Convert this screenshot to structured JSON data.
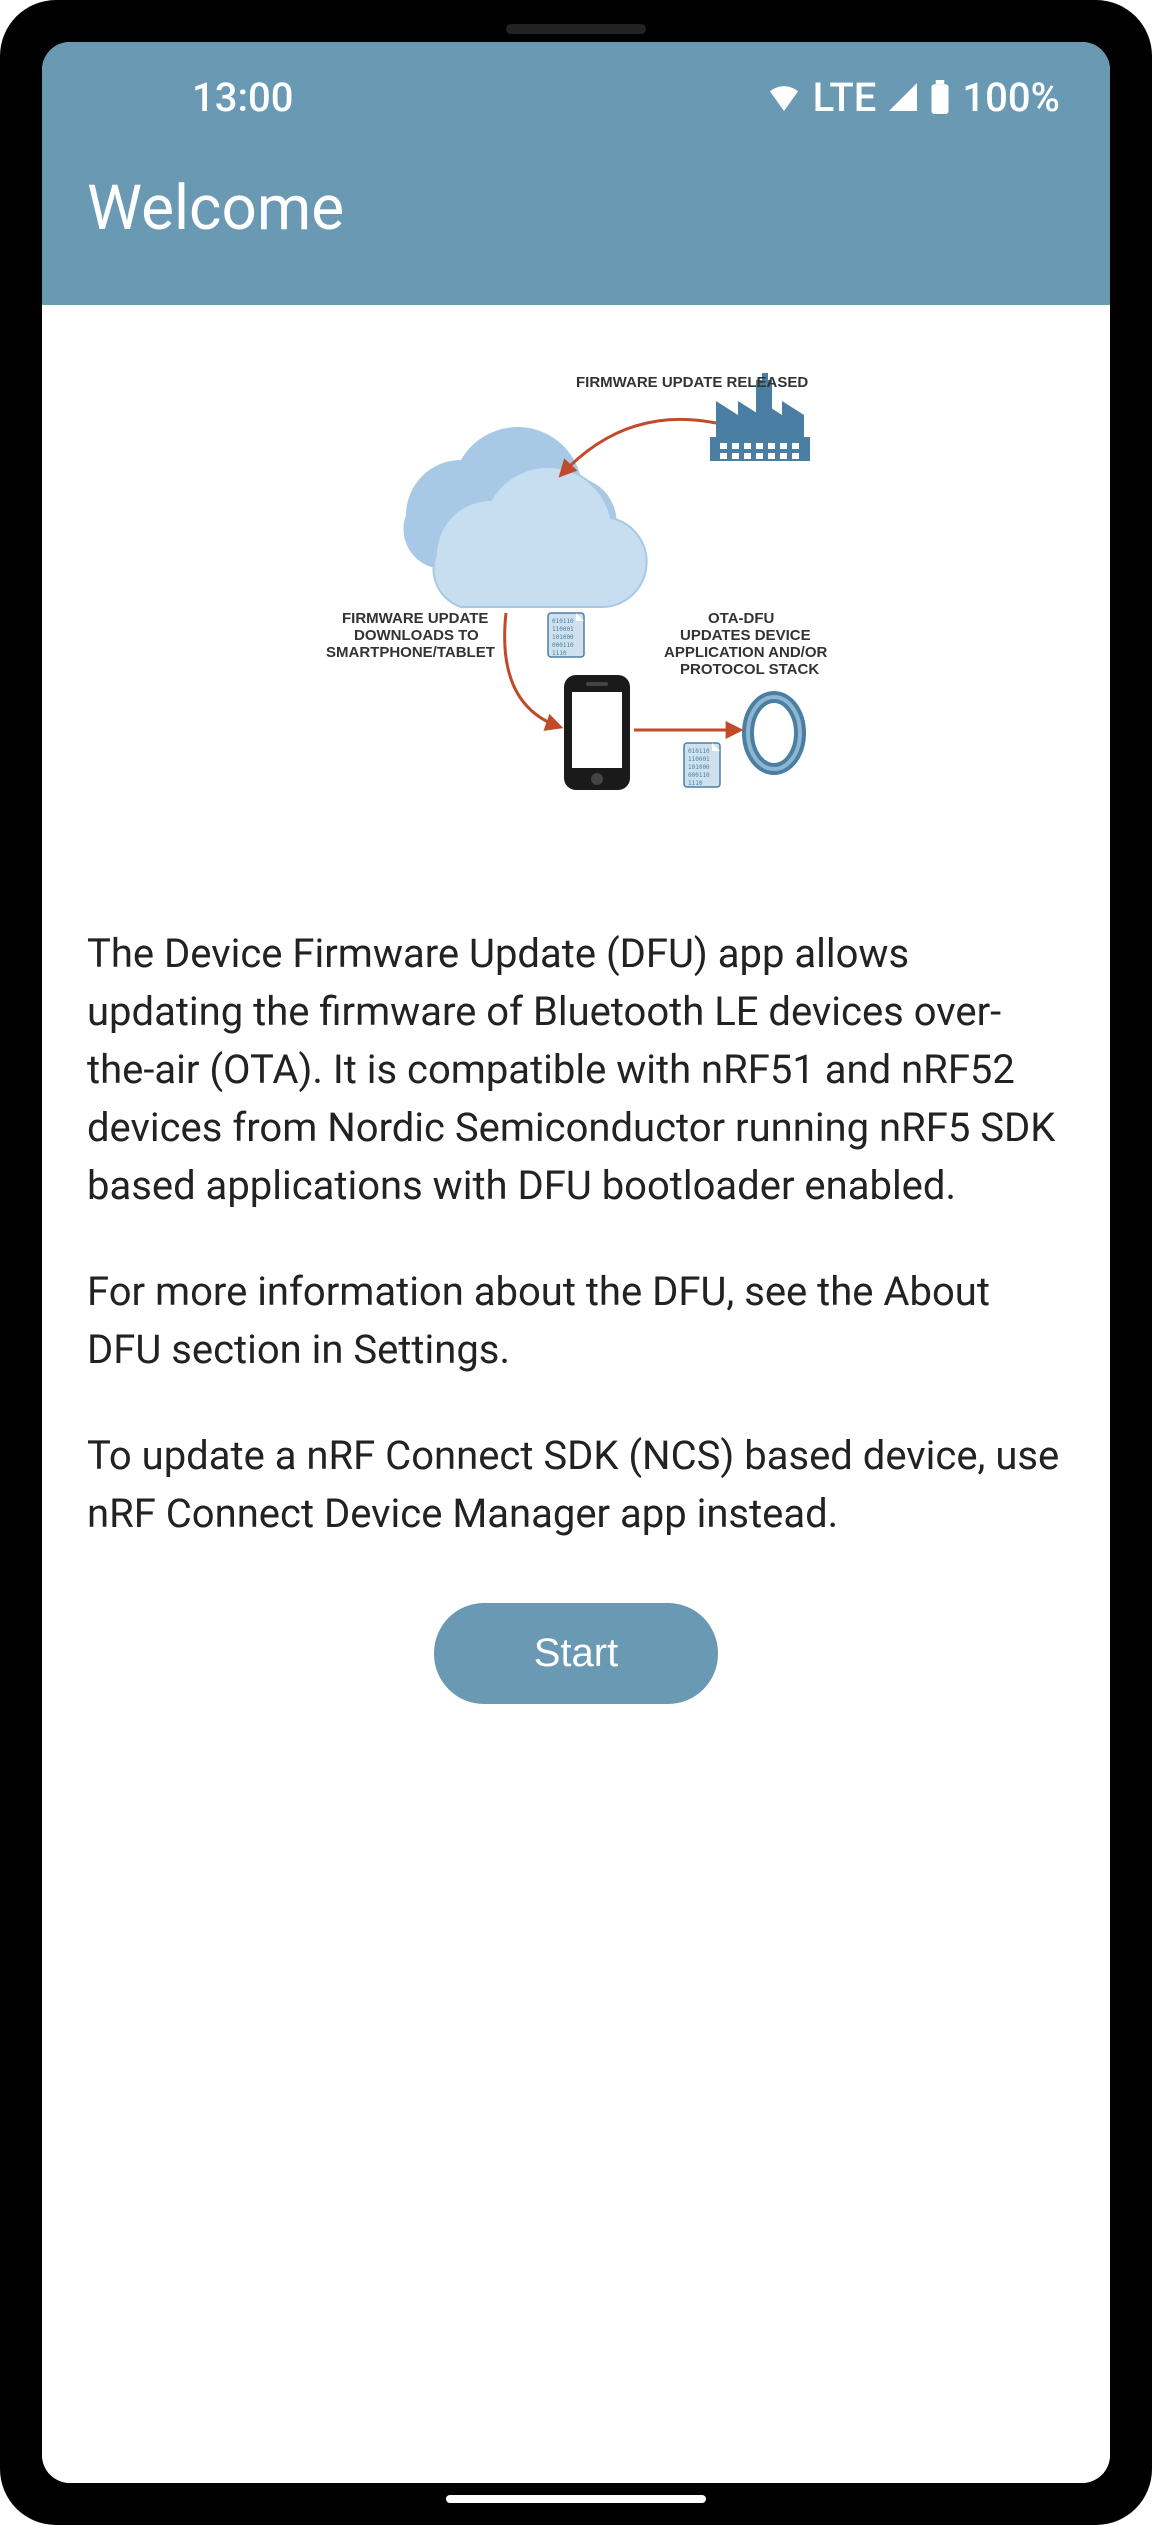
{
  "status": {
    "time": "13:00",
    "network": "LTE",
    "battery": "100%"
  },
  "header": {
    "title": "Welcome"
  },
  "illustration": {
    "label_released": "FIRMWARE UPDATE RELEASED",
    "label_download_l1": "FIRMWARE UPDATE",
    "label_download_l2": "DOWNLOADS TO",
    "label_download_l3": "SMARTPHONE/TABLET",
    "label_ota_l1": "OTA-DFU",
    "label_ota_l2": "UPDATES DEVICE",
    "label_ota_l3": "APPLICATION AND/OR",
    "label_ota_l4": "PROTOCOL STACK"
  },
  "body": {
    "p1": "The Device Firmware Update (DFU) app allows updating the firmware of Bluetooth LE devices over-the-air (OTA). It is compatible with nRF51 and nRF52 devices from Nordic Semiconductor running nRF5 SDK based applications with DFU bootloader enabled.",
    "p2": "For more information about the DFU, see the About DFU section in Settings.",
    "p3": "To update a nRF Connect SDK (NCS) based device, use nRF Connect Device Manager app instead."
  },
  "cta": {
    "start_label": "Start"
  }
}
